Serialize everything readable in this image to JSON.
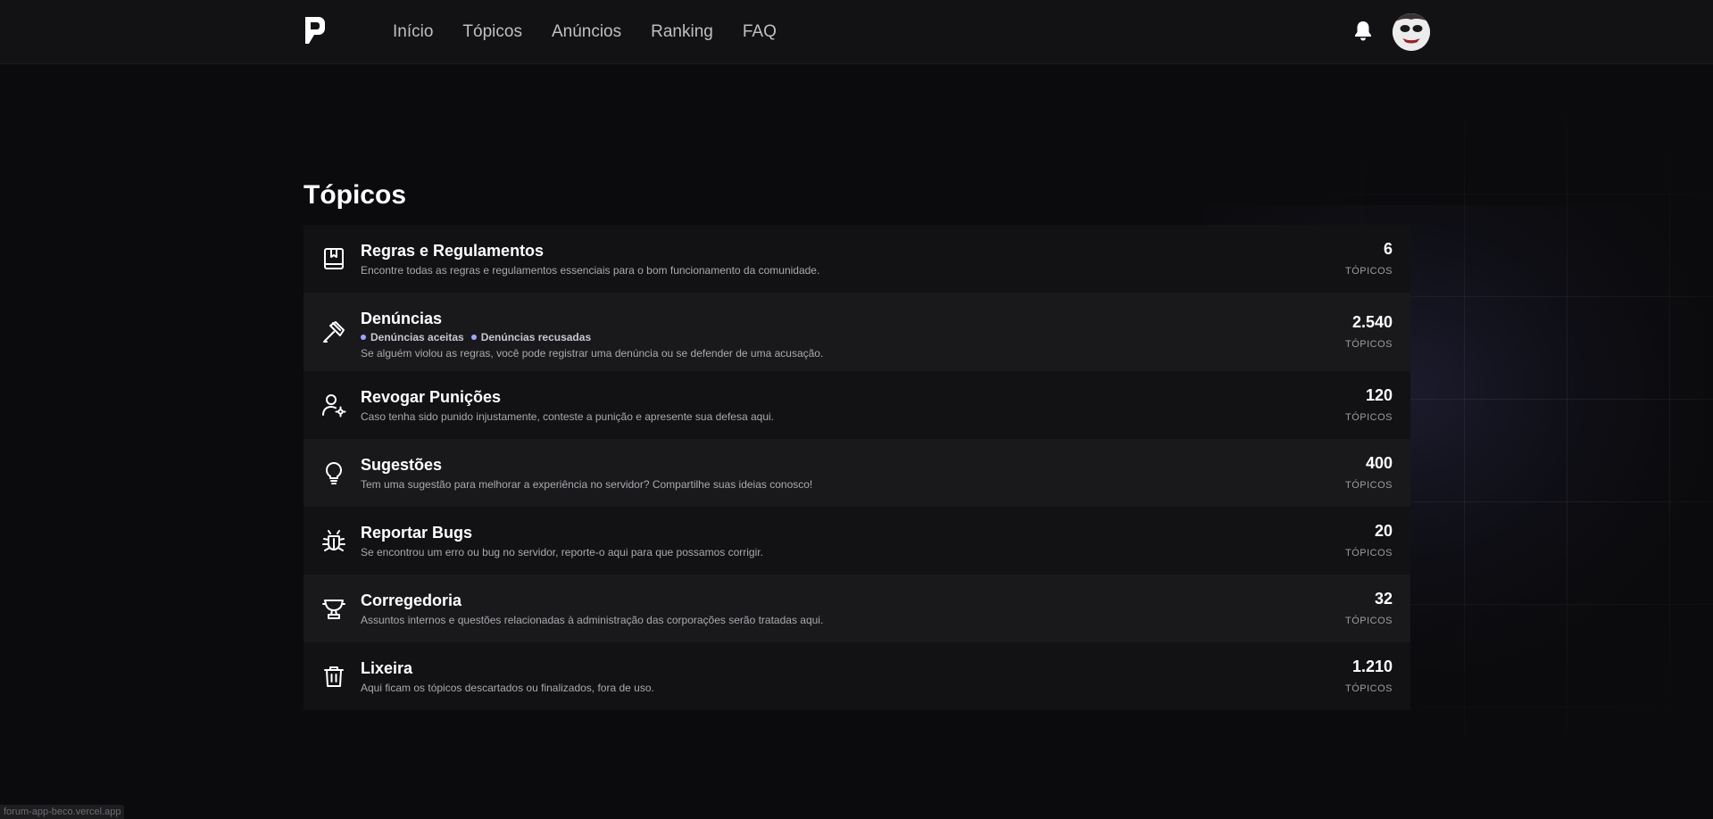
{
  "header": {
    "logo": "P",
    "nav": [
      "Início",
      "Tópicos",
      "Anúncios",
      "Ranking",
      "FAQ"
    ]
  },
  "main": {
    "title": "Tópicos",
    "categories": [
      {
        "icon": "book-icon",
        "title": "Regras e Regulamentos",
        "description": "Encontre todas as regras e regulamentos essenciais para o bom funcionamento da comunidade.",
        "count": "6",
        "count_label": "TÓPICOS"
      },
      {
        "icon": "gavel-icon",
        "title": "Denúncias",
        "subcategories": [
          "Denúncias aceitas",
          "Denúncias recusadas"
        ],
        "description": "Se alguém violou as regras, você pode registrar uma denúncia ou se defender de uma acusação.",
        "count": "2.540",
        "count_label": "TÓPICOS"
      },
      {
        "icon": "user-gear-icon",
        "title": "Revogar Punições",
        "description": "Caso tenha sido punido injustamente, conteste a punição e apresente sua defesa aqui.",
        "count": "120",
        "count_label": "TÓPICOS"
      },
      {
        "icon": "lightbulb-icon",
        "title": "Sugestões",
        "description": "Tem uma sugestão para melhorar a experiência no servidor? Compartilhe suas ideias conosco!",
        "count": "400",
        "count_label": "TÓPICOS"
      },
      {
        "icon": "bug-icon",
        "title": "Reportar Bugs",
        "description": "Se encontrou um erro ou bug no servidor, reporte-o aqui para que possamos corrigir.",
        "count": "20",
        "count_label": "TÓPICOS"
      },
      {
        "icon": "trophy-icon",
        "title": "Corregedoria",
        "description": "Assuntos internos e questões relacionadas à administração das corporações serão tratadas aqui.",
        "count": "32",
        "count_label": "TÓPICOS"
      },
      {
        "icon": "trash-icon",
        "title": "Lixeira",
        "description": "Aqui ficam os tópicos descartados ou finalizados, fora de uso.",
        "count": "1.210",
        "count_label": "TÓPICOS"
      }
    ]
  },
  "statusbar": {
    "text": "forum-app-beco.vercel.app"
  },
  "colors": {
    "background": "#0b0b0d",
    "header": "#121214",
    "row": "#121214",
    "row_alt": "#19191b",
    "accent_dot": "#9fa4ff"
  }
}
